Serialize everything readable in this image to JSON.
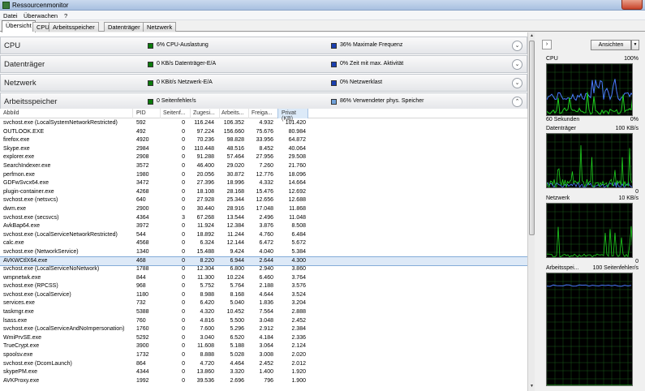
{
  "window": {
    "title": "Ressourcenmonitor"
  },
  "menu": [
    "Datei",
    "Überwachen",
    "?"
  ],
  "tabs": [
    "Übersicht",
    "CPU",
    "Arbeitsspeicher",
    "Datenträger",
    "Netzwerk"
  ],
  "sections": [
    {
      "title": "CPU",
      "stat1": "6% CPU-Auslastung",
      "stat2": "36% Maximale Frequenz",
      "sq1": "#0a7a0a",
      "sq2": "#1a3fb0"
    },
    {
      "title": "Datenträger",
      "stat1": "0 KB/s Datenträger-E/A",
      "stat2": "0% Zeit mit max. Aktivität",
      "sq1": "#0a7a0a",
      "sq2": "#1a3fb0"
    },
    {
      "title": "Netzwerk",
      "stat1": "0 KBit/s Netzwerk-E/A",
      "stat2": "0% Netzwerklast",
      "sq1": "#0a7a0a",
      "sq2": "#1a3fb0"
    },
    {
      "title": "Arbeitsspeicher",
      "stat1": "0 Seitenfehler/s",
      "stat2": "86% Verwendeter phys. Speicher",
      "sq1": "#0a7a0a",
      "sq2": "#6fa0d8"
    }
  ],
  "columns": {
    "name": "Abbild",
    "pid": "PID",
    "faults": "Seitenf...",
    "commit": "Zugesi...",
    "working": "Arbeits...",
    "shareable": "Freiga...",
    "private": "Privat (KB)"
  },
  "rows": [
    [
      "svchost.exe (LocalSystemNetworkRestricted)",
      "592",
      "0",
      "116.244",
      "106.352",
      "4.932",
      "101.420"
    ],
    [
      "OUTLOOK.EXE",
      "492",
      "0",
      "97.224",
      "156.660",
      "75.676",
      "80.984"
    ],
    [
      "firefox.exe",
      "4920",
      "0",
      "70.236",
      "98.828",
      "33.956",
      "64.872"
    ],
    [
      "Skype.exe",
      "2984",
      "0",
      "110.448",
      "48.516",
      "8.452",
      "40.064"
    ],
    [
      "explorer.exe",
      "2908",
      "0",
      "91.288",
      "57.464",
      "27.956",
      "29.508"
    ],
    [
      "SearchIndexer.exe",
      "3572",
      "0",
      "46.400",
      "29.020",
      "7.260",
      "21.760"
    ],
    [
      "perfmon.exe",
      "1980",
      "0",
      "20.056",
      "30.872",
      "12.776",
      "18.096"
    ],
    [
      "GDFwSvcx64.exe",
      "3472",
      "0",
      "27.396",
      "18.996",
      "4.332",
      "14.664"
    ],
    [
      "plugin-container.exe",
      "4268",
      "0",
      "18.108",
      "28.168",
      "15.476",
      "12.692"
    ],
    [
      "svchost.exe (netsvcs)",
      "640",
      "0",
      "27.928",
      "25.344",
      "12.656",
      "12.688"
    ],
    [
      "dwm.exe",
      "2900",
      "0",
      "30.440",
      "28.916",
      "17.048",
      "11.868"
    ],
    [
      "svchost.exe (secsvcs)",
      "4364",
      "3",
      "67.268",
      "13.544",
      "2.496",
      "11.048"
    ],
    [
      "AvkBap64.exe",
      "3972",
      "0",
      "11.924",
      "12.384",
      "3.876",
      "8.508"
    ],
    [
      "svchost.exe (LocalServiceNetworkRestricted)",
      "544",
      "0",
      "18.892",
      "11.244",
      "4.760",
      "6.484"
    ],
    [
      "calc.exe",
      "4568",
      "0",
      "6.324",
      "12.144",
      "6.472",
      "5.672"
    ],
    [
      "svchost.exe (NetworkService)",
      "1340",
      "0",
      "15.488",
      "9.424",
      "4.040",
      "5.384"
    ],
    [
      "AVKWCtlX64.exe",
      "468",
      "0",
      "8.220",
      "6.944",
      "2.644",
      "4.300"
    ],
    [
      "svchost.exe (LocalServiceNoNetwork)",
      "1788",
      "0",
      "12.304",
      "6.800",
      "2.940",
      "3.860"
    ],
    [
      "wmpnetwk.exe",
      "844",
      "0",
      "11.300",
      "10.224",
      "6.460",
      "3.764"
    ],
    [
      "svchost.exe (RPCSS)",
      "968",
      "0",
      "5.752",
      "5.764",
      "2.188",
      "3.576"
    ],
    [
      "svchost.exe (LocalService)",
      "1180",
      "0",
      "8.988",
      "8.168",
      "4.644",
      "3.524"
    ],
    [
      "services.exe",
      "732",
      "0",
      "6.420",
      "5.040",
      "1.836",
      "3.204"
    ],
    [
      "taskmgr.exe",
      "5388",
      "0",
      "4.320",
      "10.452",
      "7.564",
      "2.888"
    ],
    [
      "lsass.exe",
      "760",
      "0",
      "4.816",
      "5.500",
      "3.048",
      "2.452"
    ],
    [
      "svchost.exe (LocalServiceAndNoImpersonation)",
      "1760",
      "0",
      "7.600",
      "5.296",
      "2.912",
      "2.384"
    ],
    [
      "WmiPrvSE.exe",
      "5292",
      "0",
      "3.040",
      "6.520",
      "4.184",
      "2.336"
    ],
    [
      "TrueCrypt.exe",
      "3900",
      "0",
      "11.608",
      "5.188",
      "3.064",
      "2.124"
    ],
    [
      "spoolsv.exe",
      "1732",
      "0",
      "8.888",
      "5.028",
      "3.008",
      "2.020"
    ],
    [
      "svchost.exe (DcomLaunch)",
      "864",
      "0",
      "4.720",
      "4.464",
      "2.452",
      "2.012"
    ],
    [
      "skypePM.exe",
      "4344",
      "0",
      "13.860",
      "3.320",
      "1.400",
      "1.920"
    ],
    [
      "AVKProxy.exe",
      "1992",
      "0",
      "39.536",
      "2.696",
      "796",
      "1.900"
    ]
  ],
  "selected_row": 16,
  "right_panel": {
    "view_button": "Ansichten",
    "cpu": {
      "label": "CPU",
      "max": "100%",
      "footer_left": "60 Sekunden",
      "footer_right": "0%"
    },
    "disk": {
      "label": "Datenträger",
      "max": "100 KB/s",
      "footer_right": "0"
    },
    "network": {
      "label": "Netzwerk",
      "max": "10 KB/s",
      "footer_right": "0"
    },
    "memory": {
      "label": "Arbeitsspei...",
      "max": "100 Seitenfehler/s"
    }
  },
  "colors": {
    "graph_green": "#1ed01e",
    "graph_blue": "#4a7cff",
    "graph_grid": "#1a5a1a"
  }
}
